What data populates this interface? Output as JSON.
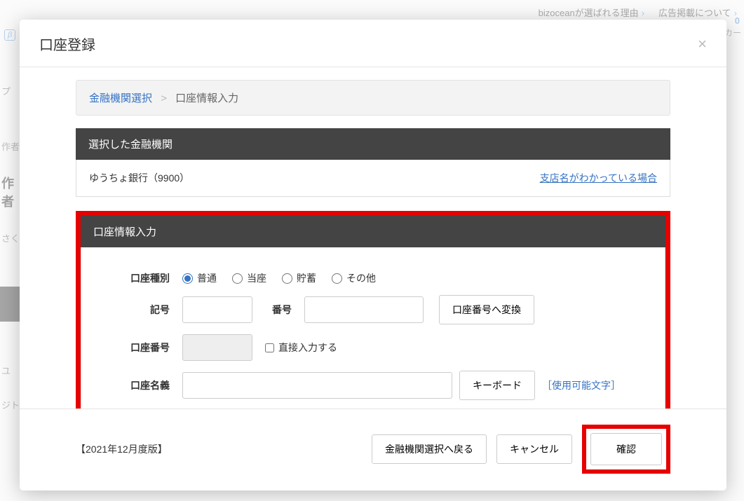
{
  "bg": {
    "link1": "bizoceanが選ばれる理由",
    "link2": "広告掲載について",
    "beta": "β",
    "side1": "プ",
    "side2": "作者",
    "side3": "作者",
    "side4": "さく",
    "side5": "ユ",
    "side6": "ジト",
    "cart_label": "カー",
    "cart_count": "0"
  },
  "modal": {
    "title": "口座登録",
    "breadcrumb": {
      "step1": "金融機関選択",
      "step2": "口座情報入力"
    },
    "selected_inst_header": "選択した金融機関",
    "selected_inst_value": "ゆうちょ銀行（9900）",
    "branch_known_link": "支店名がわかっている場合",
    "form_header": "口座情報入力",
    "labels": {
      "account_type": "口座種別",
      "symbol": "記号",
      "number": "番号",
      "account_number": "口座番号",
      "account_name": "口座名義"
    },
    "radios": {
      "futsuu": "普通",
      "touza": "当座",
      "chochiku": "貯蓄",
      "sonota": "その他"
    },
    "buttons": {
      "convert_to_account_number": "口座番号へ変換",
      "direct_input": "直接入力する",
      "keyboard": "キーボード",
      "allowed_chars": "［使用可能文字］"
    },
    "footer": {
      "version": "【2021年12月度版】",
      "back_to_inst": "金融機関選択へ戻る",
      "cancel": "キャンセル",
      "confirm": "確認"
    }
  }
}
